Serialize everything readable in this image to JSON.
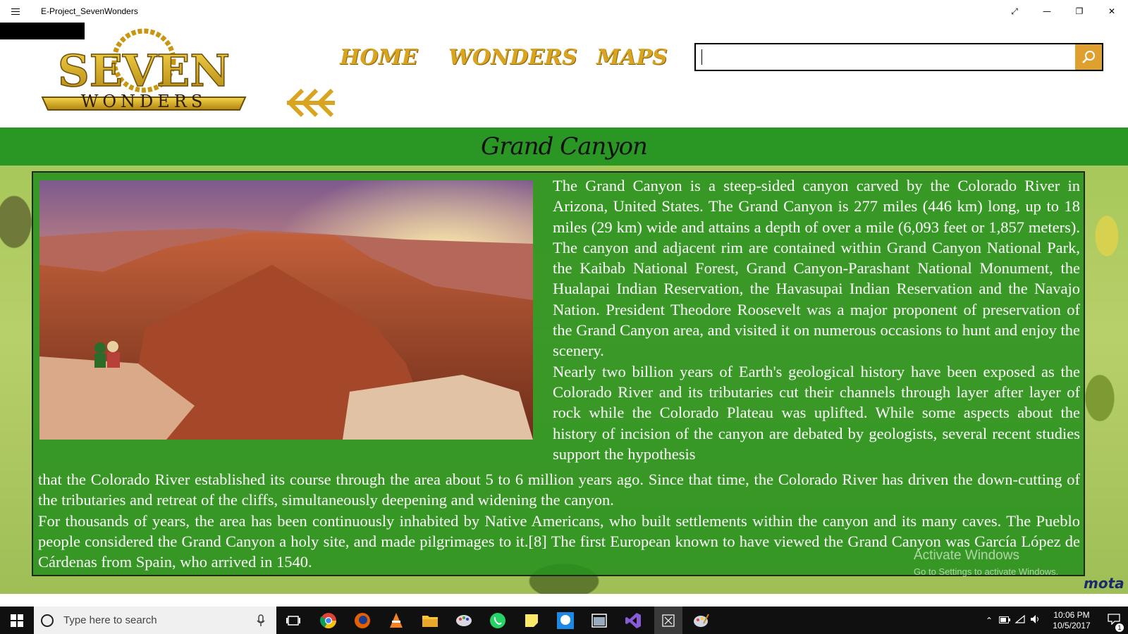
{
  "window": {
    "title": "E-Project_SevenWonders",
    "controls": [
      "⤢",
      "—",
      "❐",
      "✕"
    ]
  },
  "logo": {
    "top_text": "SEVEN",
    "bottom_text": "WONDERS"
  },
  "nav": {
    "home": "HOME",
    "wonders": "WONDERS",
    "maps": "MAPS"
  },
  "search": {
    "value": "",
    "placeholder": ""
  },
  "page": {
    "title": "Grand Canyon",
    "paragraph_right": "The Grand Canyon is a steep-sided canyon carved by the Colorado River in Arizona, United States. The Grand Canyon is 277 miles (446 km) long, up to 18 miles (29 km) wide and attains a depth of over a mile (6,093 feet or 1,857 meters). The canyon and adjacent rim are contained within Grand Canyon National Park, the Kaibab National Forest, Grand Canyon-Parashant National Monument, the Hualapai Indian Reservation, the Havasupai Indian Reservation and the Navajo Nation. President Theodore Roosevelt was a major proponent of preservation of the Grand Canyon area, and visited it on numerous occasions to hunt and enjoy the scenery.",
    "paragraph_right_2": "Nearly two billion years of Earth's geological history have been exposed as the Colorado River and its tributaries cut their channels through layer after layer of rock while the Colorado Plateau was uplifted. While some aspects about the history of incision of the canyon are debated by geologists, several recent studies support the hypothesis",
    "paragraph_bottom": "that the Colorado River established its course through the area about 5 to 6 million years ago. Since that time, the Colorado River has driven the down-cutting of the tributaries and retreat of the cliffs, simultaneously deepening and widening the canyon.",
    "paragraph_bottom_2": "For thousands of years, the area has been continuously inhabited by Native Americans, who built settlements within the canyon and its many caves. The Pueblo people considered the Grand Canyon a holy site, and made pilgrimages to it.[8] The first European known to have viewed the Grand Canyon was García López de Cárdenas from Spain, who arrived in 1540."
  },
  "activation": {
    "line1": "Activate Windows",
    "line2": "Go to Settings to activate Windows."
  },
  "watermark": "mota",
  "taskbar": {
    "search_placeholder": "Type here to search",
    "time": "10:06 PM",
    "date": "10/5/2017",
    "notification_count": "1"
  },
  "colors": {
    "nav_gold": "#d9a420",
    "title_band": "#2a9624",
    "search_button": "#e0a030"
  }
}
